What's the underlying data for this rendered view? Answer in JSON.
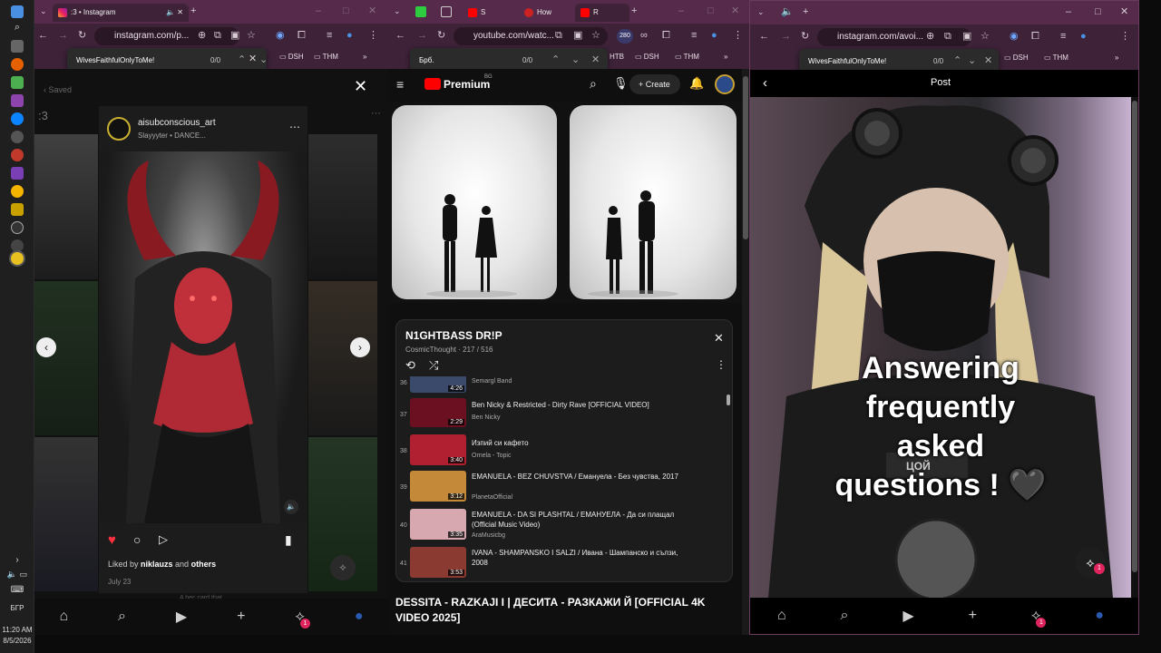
{
  "taskbar": {
    "lang": "БГР",
    "time": "11:20 AM",
    "date": "8/5/2026"
  },
  "win1": {
    "tab_title": ":3 • Instagram",
    "url": "instagram.com/p...",
    "find_query": "WivesFaithfulOnlyToMe!",
    "find_count": "0/0",
    "bookmarks": [
      "DSH",
      "THM"
    ],
    "saved_label": "Saved",
    "collection_label": ":3",
    "post": {
      "username": "aisubconscious_art",
      "subtitle": "Slayyyter • DANCE...",
      "liked_prefix": "Liked by ",
      "liked_user": "niklauzs",
      "liked_mid": " and ",
      "liked_others": "others",
      "date": "July 23",
      "caption_peek": "A bec card that"
    },
    "nav_badge": "1"
  },
  "win2": {
    "tabs": [
      "S",
      "How",
      "R"
    ],
    "url": "youtube.com/watc...",
    "ext_badge": "280",
    "find_query": "Брб.",
    "find_count": "0/0",
    "bookmarks": [
      "НТВ",
      "DSH",
      "THM"
    ],
    "brand": "Premium",
    "brand_sup": "BG",
    "create_label": "Create",
    "playlist": {
      "title": "N1GHTBASS DR!P",
      "meta": "CosmicThought · 217 / 516",
      "items": [
        {
          "num": "36",
          "title": "",
          "channel": "Semargl Band",
          "duration": "4:26",
          "thumb": "#3b4a6b"
        },
        {
          "num": "37",
          "title": "Ben Nicky & Restricted - Dirty Rave [OFFICIAL VIDEO]",
          "channel": "Ben Nicky",
          "duration": "2:29",
          "thumb": "#6b1020"
        },
        {
          "num": "38",
          "title": "Изпий си кафето",
          "channel": "Ornela - Topic",
          "duration": "3:40",
          "thumb": "#b02030"
        },
        {
          "num": "39",
          "title": "EMANUELA - BEZ CHUVSTVA / Емануела - Без чувства, 2017",
          "channel": "PlanetaOfficial",
          "duration": "3:12",
          "thumb": "#c48a3a"
        },
        {
          "num": "40",
          "title": "EMANUELA - DA SI PLASHTAL / ЕМАНУЕЛА - Да си плащал (Official Music Video)",
          "channel": "AraMusicbg",
          "duration": "3:35",
          "thumb": "#d8a8b0"
        },
        {
          "num": "41",
          "title": "IVANA - SHAMPANSKO I SALZI / Ивана - Шампанско и сълзи, 2008",
          "channel": "",
          "duration": "3:53",
          "thumb": "#8a3a30"
        }
      ]
    },
    "video_title": "DESSITA - RAZKAJI I | ДЕСИТА - РАЗКАЖИ Й [OFFICIAL 4K VIDEO 2025]"
  },
  "win3": {
    "url": "instagram.com/avoi...",
    "find_query": "WivesFaithfulOnlyToMe!",
    "find_count": "0/0",
    "bookmarks": [
      "DSH",
      "THM"
    ],
    "header_title": "Post",
    "overlay_line1": "Answering",
    "overlay_line2": "frequently",
    "overlay_line3": "asked",
    "overlay_line4": "questions ! 🖤",
    "patch_text": "ЦОЙ",
    "nav_badge": "1"
  }
}
